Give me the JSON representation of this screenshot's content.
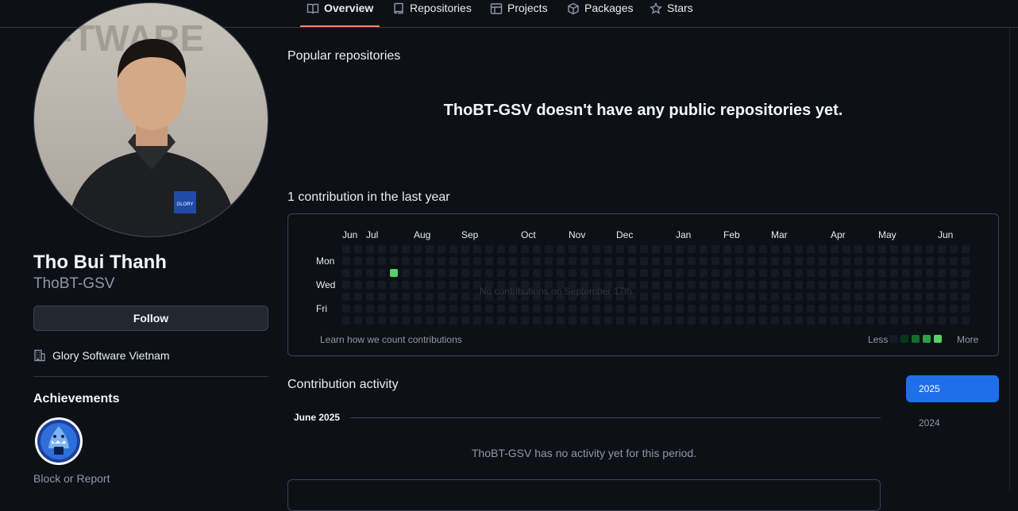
{
  "nav": {
    "tabs": [
      {
        "label": "Overview",
        "icon": "book-icon"
      },
      {
        "label": "Repositories",
        "icon": "repo-icon"
      },
      {
        "label": "Projects",
        "icon": "table-icon"
      },
      {
        "label": "Packages",
        "icon": "package-icon"
      },
      {
        "label": "Stars",
        "icon": "star-icon"
      }
    ]
  },
  "profile": {
    "avatar_background_text": "FTWARE",
    "shirt_logo_text": "GLORY",
    "name": "Tho Bui Thanh",
    "login": "ThoBT-GSV",
    "follow_label": "Follow",
    "organization": "Glory Software Vietnam",
    "achievements_title": "Achievements",
    "block_report_label": "Block or Report"
  },
  "main": {
    "popular_title": "Popular repositories",
    "empty_repos": "ThoBT-GSV doesn't have any public repositories yet.",
    "contrib_title": "1 contribution in the last year",
    "graph": {
      "months": [
        "Jun",
        "Jul",
        "Aug",
        "Sep",
        "Oct",
        "Nov",
        "Dec",
        "Jan",
        "Feb",
        "Mar",
        "Apr",
        "May",
        "Jun"
      ],
      "days": [
        "Mon",
        "Wed",
        "Fri"
      ],
      "tooltip": "No contributions on September 17th",
      "learn_link": "Learn how we count contributions",
      "legend_less": "Less",
      "legend_more": "More",
      "colors": [
        "#151b23",
        "#033a16",
        "#196c2e",
        "#2ea043",
        "#56d364"
      ]
    },
    "activity_title": "Contribution activity",
    "activity_month": "June 2025",
    "no_activity": "ThoBT-GSV has no activity yet for this period.",
    "years": [
      "2025",
      "2024"
    ]
  },
  "chart_data": {
    "type": "heatmap",
    "title": "1 contribution in the last year",
    "weeks": 53,
    "days_per_week": 7,
    "x_labels": [
      "Jun",
      "Jul",
      "Aug",
      "Sep",
      "Oct",
      "Nov",
      "Dec",
      "Jan",
      "Feb",
      "Mar",
      "Apr",
      "May",
      "Jun"
    ],
    "y_labels": [
      "Mon",
      "Wed",
      "Fri"
    ],
    "nonzero_cells": [
      {
        "week": 4,
        "day": 2,
        "value": 1
      }
    ],
    "total": 1
  }
}
